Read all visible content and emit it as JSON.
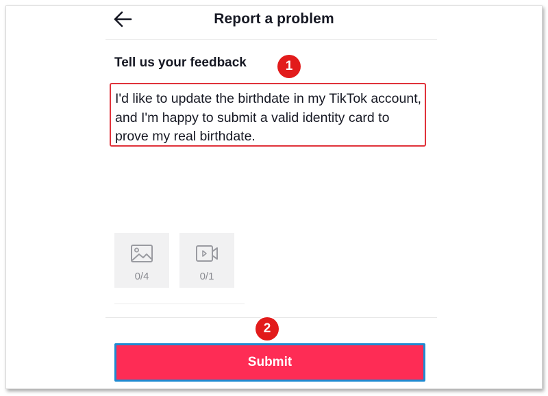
{
  "header": {
    "title": "Report a problem",
    "back_icon": "arrow-left-icon"
  },
  "feedback": {
    "label": "Tell us your feedback",
    "text": "I'd like to update the birthdate in my TikTok account, and I'm happy to submit a valid identity card to prove my real birthdate."
  },
  "attachments": {
    "photo": {
      "icon": "image-icon",
      "count": "0/4"
    },
    "video": {
      "icon": "video-icon",
      "count": "0/1"
    }
  },
  "annotations": {
    "step1": "1",
    "step2": "2"
  },
  "submit": {
    "label": "Submit"
  },
  "colors": {
    "submit_bg": "#fe2c55",
    "annotation_red": "#e21b1b",
    "highlight_blue": "#1f8ad1",
    "box_border": "#e0323a"
  }
}
